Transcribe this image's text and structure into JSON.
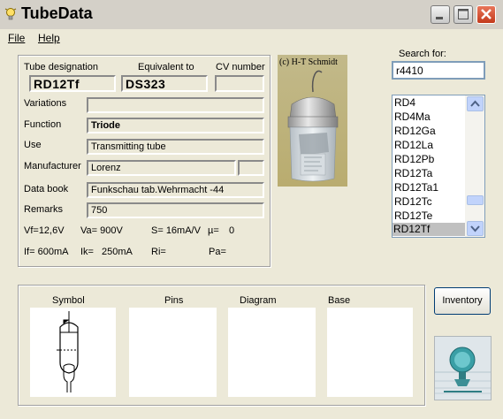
{
  "window": {
    "title": "TubeData"
  },
  "menu": {
    "file": "File",
    "help": "Help"
  },
  "header": {
    "designation_label": "Tube designation",
    "designation_value": "RD12Tf",
    "equivalent_label": "Equivalent to",
    "equivalent_value": "DS323",
    "cv_label": "CV number",
    "cv_value": ""
  },
  "details": {
    "variations_label": "Variations",
    "variations_value": "",
    "function_label": "Function",
    "function_value": "Triode",
    "use_label": "Use",
    "use_value": "Transmitting tube",
    "manufacturer_label": "Manufacturer",
    "manufacturer_value": "Lorenz",
    "manufacturer_code": "",
    "databook_label": "Data book",
    "databook_value": "Funkschau tab.Wehrmacht -44",
    "remarks_label": "Remarks",
    "remarks_value": "750"
  },
  "params": {
    "vf": "Vf=12,6V",
    "va": "Va= 900V",
    "s": "S= 16mA/V",
    "mu": "µ=",
    "mu_value": "0",
    "if": "If= 600mA",
    "ik": "Ik=",
    "ik_value": "250mA",
    "ri": "Ri=",
    "pa": "Pa="
  },
  "photo": {
    "credit": "(c) H-T Schmidt"
  },
  "search": {
    "label": "Search for:",
    "value": "r4410"
  },
  "tube_list": [
    "RD4",
    "RD4Ma",
    "RD12Ga",
    "RD12La",
    "RD12Pb",
    "RD12Ta",
    "RD12Ta1",
    "RD12Tc",
    "RD12Te",
    "RD12Tf"
  ],
  "selected_tube": "RD12Tf",
  "bottom": {
    "symbol_label": "Symbol",
    "pins_label": "Pins",
    "diagram_label": "Diagram",
    "base_label": "Base",
    "inventory_button": "Inventory"
  },
  "icons": {
    "app": "lightbulb-icon",
    "minimize": "minimize-icon",
    "maximize": "maximize-icon",
    "close": "close-icon",
    "scroll_up": "scroll-up-icon",
    "scroll_down": "scroll-down-icon"
  },
  "colors": {
    "window_bg": "#ece9d8",
    "list_selection": "#c0c0c0",
    "close_button": "#c33a1c"
  }
}
